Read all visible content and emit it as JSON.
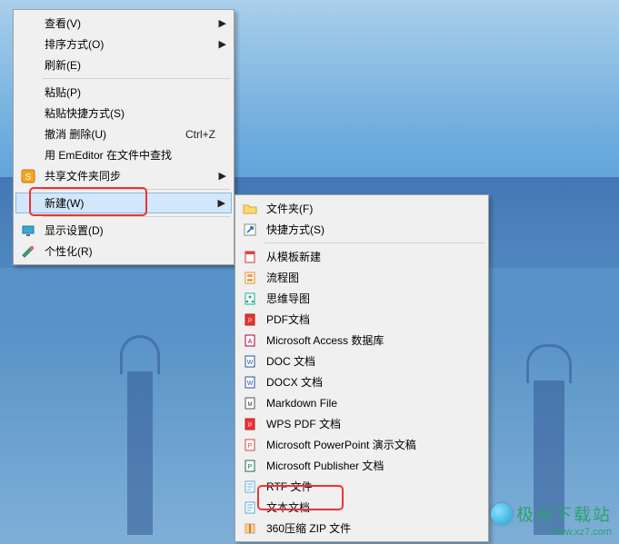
{
  "main_menu": {
    "items": [
      {
        "label": "查看(V)",
        "has_submenu": true
      },
      {
        "label": "排序方式(O)",
        "has_submenu": true
      },
      {
        "label": "刷新(E)"
      },
      {
        "sep": true
      },
      {
        "label": "粘贴(P)"
      },
      {
        "label": "粘贴快捷方式(S)"
      },
      {
        "label": "撤消 删除(U)",
        "accel": "Ctrl+Z"
      },
      {
        "label": "用 EmEditor 在文件中查找"
      },
      {
        "label": "共享文件夹同步",
        "has_submenu": true,
        "icon": "sync-icon"
      },
      {
        "sep": true
      },
      {
        "label": "新建(W)",
        "has_submenu": true,
        "selected": true
      },
      {
        "sep": true
      },
      {
        "label": "显示设置(D)",
        "icon": "display-icon"
      },
      {
        "label": "个性化(R)",
        "icon": "personalize-icon"
      }
    ]
  },
  "sub_menu": {
    "items": [
      {
        "label": "文件夹(F)",
        "icon": "folder-icon"
      },
      {
        "label": "快捷方式(S)",
        "icon": "shortcut-icon"
      },
      {
        "sep": true
      },
      {
        "label": "从模板新建",
        "icon": "template-icon"
      },
      {
        "label": "流程图",
        "icon": "flow-icon"
      },
      {
        "label": "思维导图",
        "icon": "mind-icon"
      },
      {
        "label": "PDF文档",
        "icon": "pdf-icon"
      },
      {
        "label": "Microsoft Access 数据库",
        "icon": "access-icon"
      },
      {
        "label": "DOC 文档",
        "icon": "doc-icon"
      },
      {
        "label": "DOCX 文档",
        "icon": "docx-icon"
      },
      {
        "label": "Markdown File",
        "icon": "md-icon"
      },
      {
        "label": "WPS PDF 文档",
        "icon": "wpspdf-icon"
      },
      {
        "label": "Microsoft PowerPoint 演示文稿",
        "icon": "ppt-icon"
      },
      {
        "label": "Microsoft Publisher 文档",
        "icon": "pub-icon"
      },
      {
        "label": "RTF 文件",
        "icon": "rtf-icon"
      },
      {
        "label": "文本文档",
        "icon": "txt-icon"
      },
      {
        "label": "360压缩 ZIP 文件",
        "icon": "zip-icon"
      }
    ]
  },
  "watermark": {
    "line1": "极光下载站",
    "line2": "www.xz7.com"
  }
}
